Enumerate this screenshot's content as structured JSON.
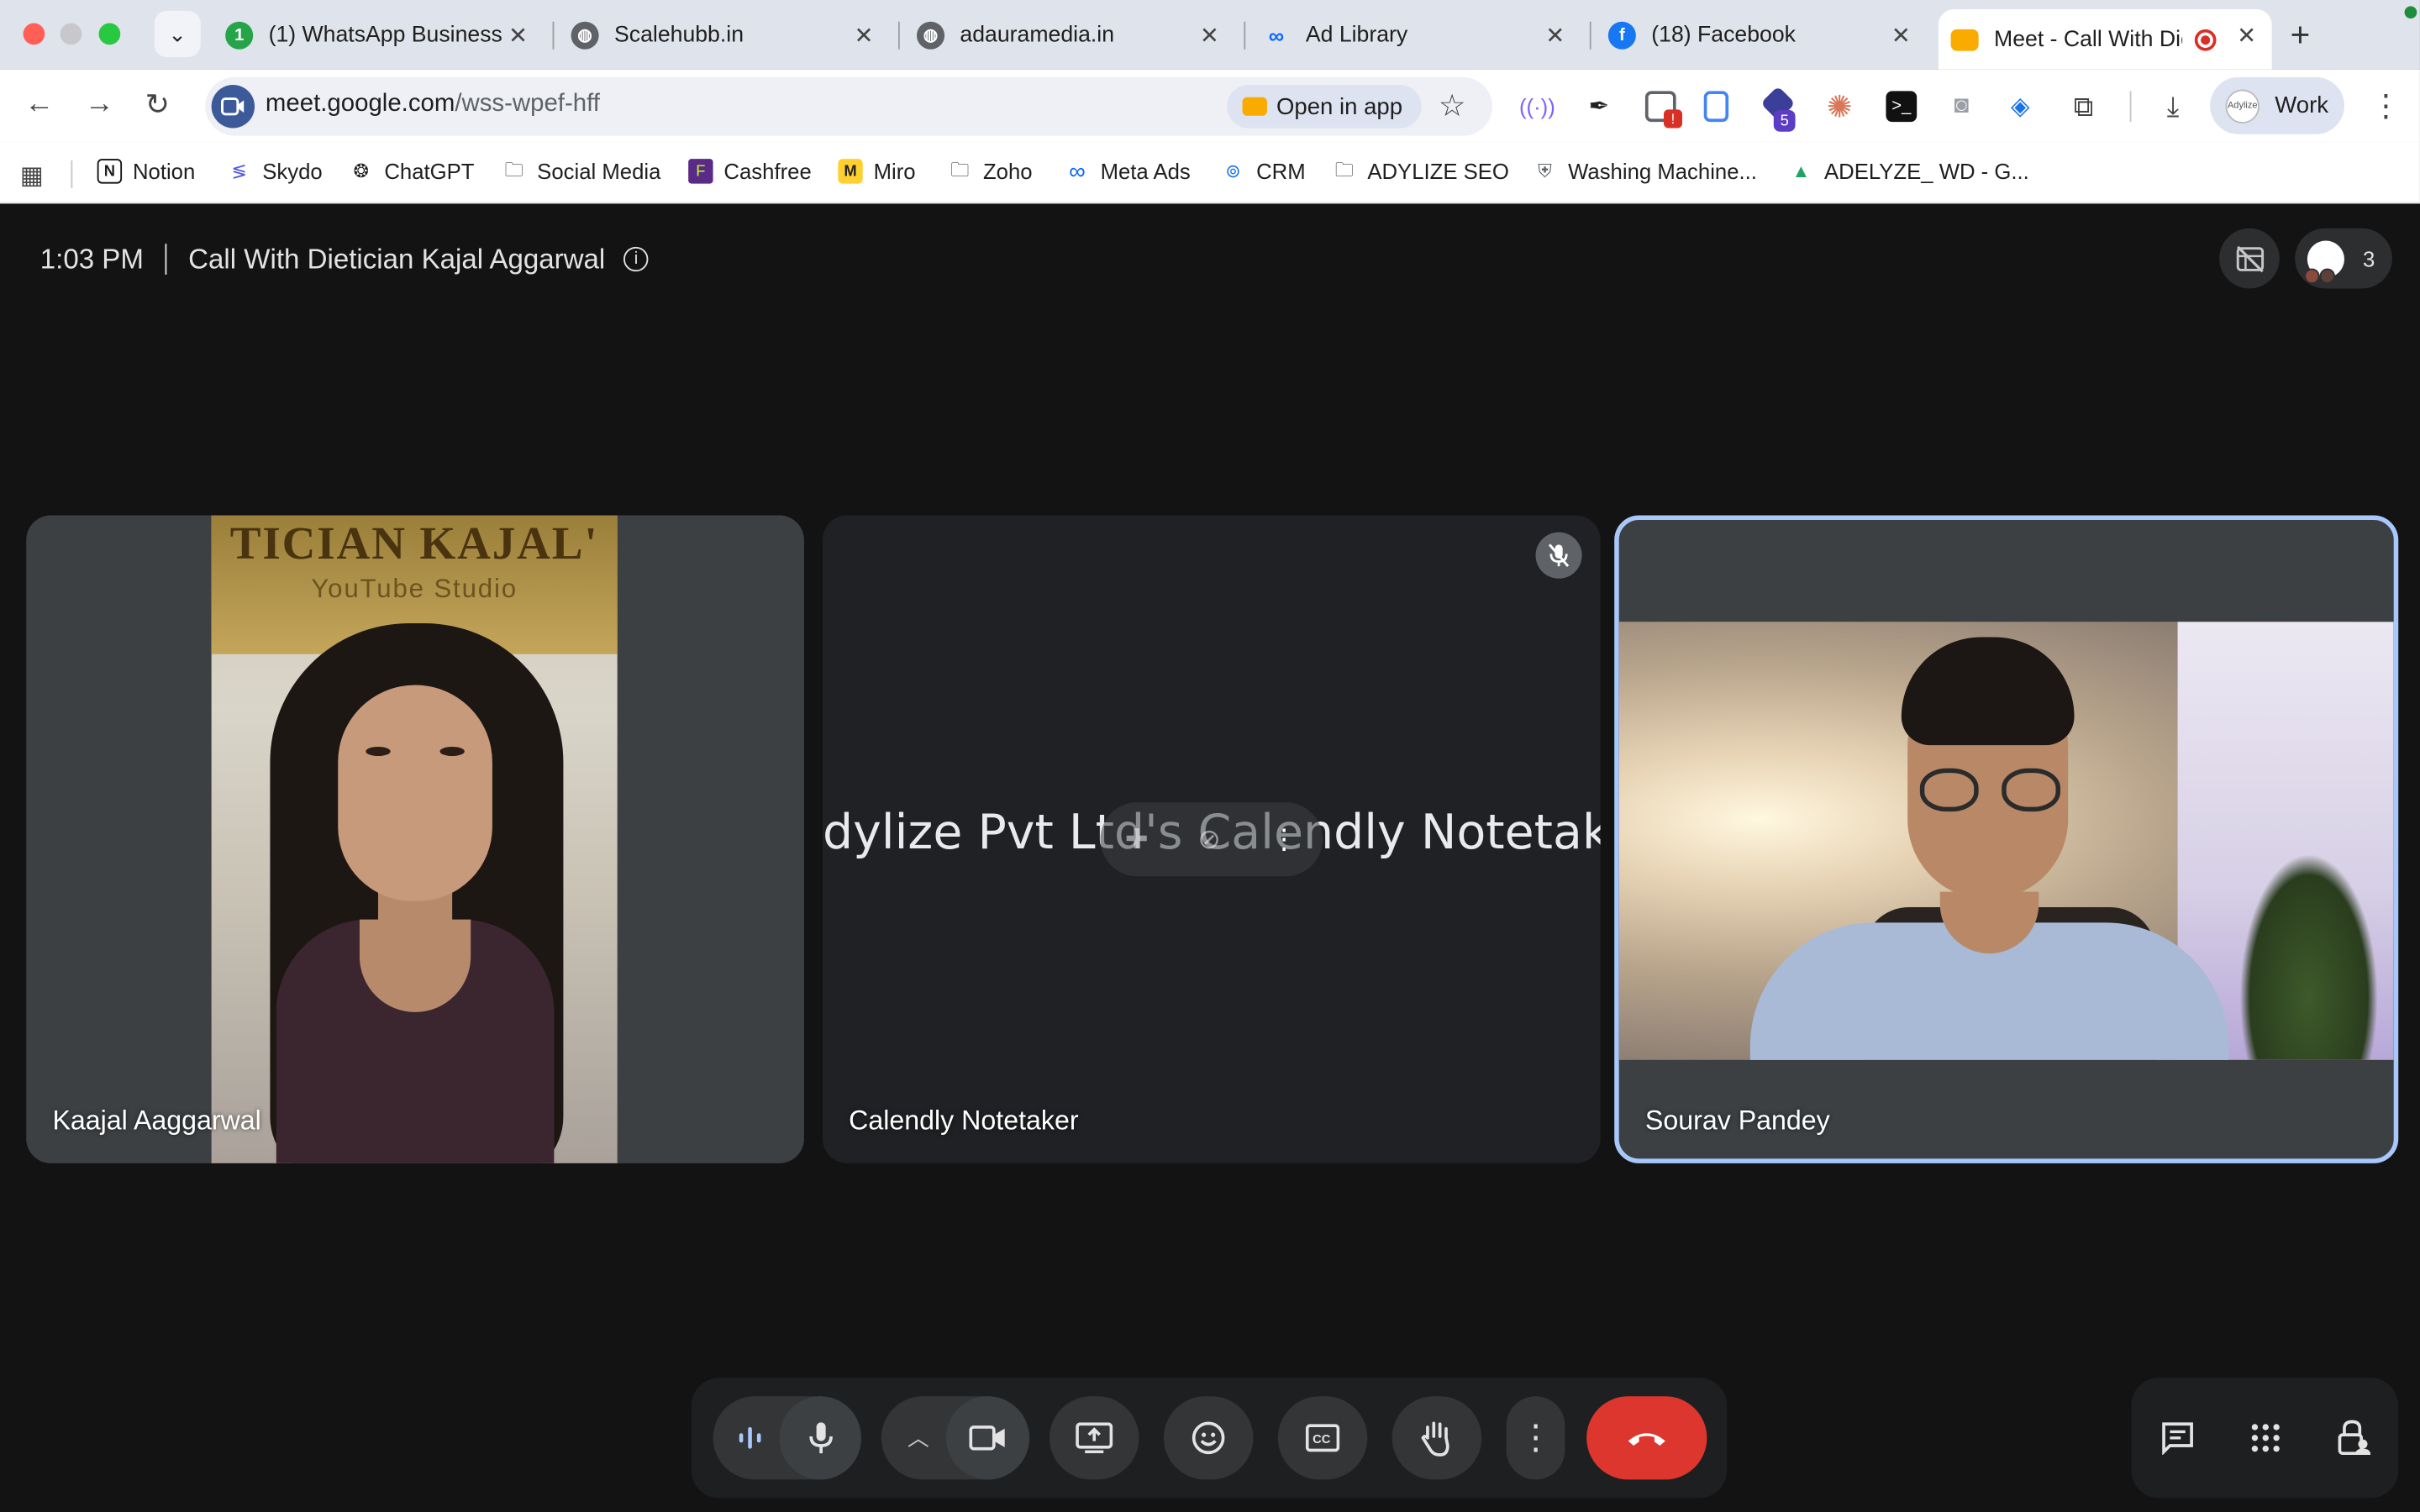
{
  "browser": {
    "tabs": [
      {
        "title": "(1) WhatsApp Business",
        "badge": "1"
      },
      {
        "title": "Scalehubb.in"
      },
      {
        "title": "adauramedia.in"
      },
      {
        "title": "Ad Library"
      },
      {
        "title": "(18) Facebook"
      },
      {
        "title": "Meet - Call With Die"
      }
    ],
    "url_host": "meet.google.com",
    "url_path": "/wss-wpef-hff",
    "open_in_app": "Open in app",
    "extension_badge": "5",
    "profile_label": "Work",
    "profile_avatar_text": "Adylize",
    "bookmarks": [
      "Notion",
      "Skydo",
      "ChatGPT",
      "Social Media",
      "Cashfree",
      "Miro",
      "Zoho",
      "Meta Ads",
      "CRM",
      "ADYLIZE SEO",
      "Washing Machine...",
      "ADELYZE_ WD - G..."
    ]
  },
  "meet": {
    "time": "1:03 PM",
    "title": "Call With Dietician Kajal Aggarwal",
    "participant_count": "3",
    "banner_line1": "TICIAN KAJAL'",
    "banner_line2": "YouTube Studio",
    "participants": [
      {
        "name": "Kaajal Aaggarwal"
      },
      {
        "name": "Calendly Notetaker",
        "overlay_text": "dylize Pvt Ltd's Calendly Notetaker"
      },
      {
        "name": "Sourav Pandey"
      }
    ]
  },
  "colors": {
    "end_call": "#dc362e",
    "active_speaker_border": "#a8c7fa",
    "page_bg": "#131314"
  }
}
